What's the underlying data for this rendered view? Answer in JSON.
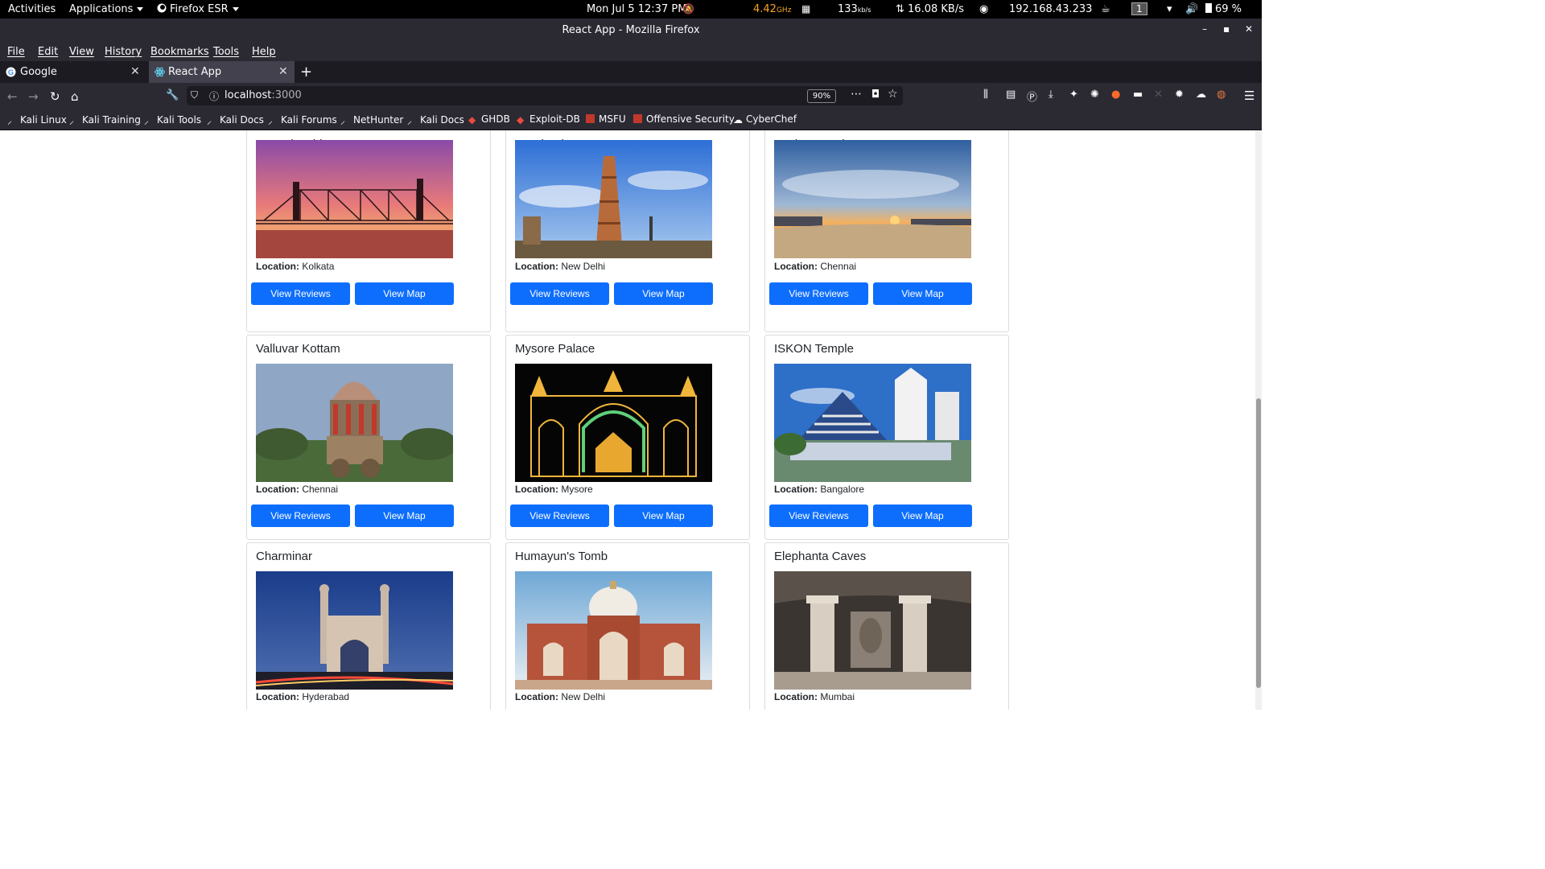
{
  "topbar": {
    "activities": "Activities",
    "applications": "Applications",
    "firefox": "Firefox ESR",
    "clock": "Mon Jul 5  12:37 PM",
    "cpu": "4.42",
    "cpu_unit": "GHz",
    "net_rate": "133",
    "net_rate_unit": "kb/s",
    "transfer": "16.08 KB/s",
    "ip": "192.168.43.233",
    "workspace": "1",
    "battery": "69 %"
  },
  "window": {
    "title": "React App - Mozilla Firefox"
  },
  "menu": [
    "File",
    "Edit",
    "View",
    "History",
    "Bookmarks",
    "Tools",
    "Help"
  ],
  "tabs": [
    {
      "label": "Google"
    },
    {
      "label": "React App"
    }
  ],
  "url": {
    "host": "localhost",
    "port": ":3000",
    "zoom": "90%"
  },
  "bookmarks": [
    "Kali Linux",
    "Kali Training",
    "Kali Tools",
    "Kali Docs",
    "Kali Forums",
    "NetHunter",
    "Kali Docs",
    "GHDB",
    "Exploit-DB",
    "MSFU",
    "Offensive Security",
    "CyberChef"
  ],
  "labels": {
    "location": "Location:",
    "view_reviews": "View Reviews",
    "view_map": "View Map"
  },
  "places": [
    {
      "name": "Howrah Bridge",
      "location": "Kolkata"
    },
    {
      "name": "Qutab Minar",
      "location": "New Delhi"
    },
    {
      "name": "Marina Beach",
      "location": "Chennai"
    },
    {
      "name": "Valluvar Kottam",
      "location": "Chennai"
    },
    {
      "name": "Mysore Palace",
      "location": "Mysore"
    },
    {
      "name": "ISKON Temple",
      "location": "Bangalore"
    },
    {
      "name": "Charminar",
      "location": "Hyderabad"
    },
    {
      "name": "Humayun's Tomb",
      "location": "New Delhi"
    },
    {
      "name": "Elephanta Caves",
      "location": "Mumbai"
    }
  ]
}
